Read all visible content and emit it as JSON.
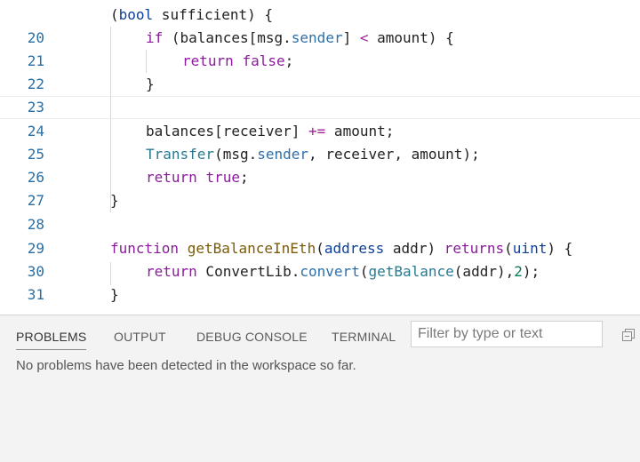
{
  "editor": {
    "lines": [
      {
        "num": "",
        "tokens": [
          [
            "(",
            "p"
          ],
          [
            "bool",
            "t"
          ],
          [
            " sufficient) {",
            "p"
          ]
        ]
      },
      {
        "num": "20",
        "tokens": [
          [
            "if",
            "k"
          ],
          [
            " (balances[",
            "p"
          ],
          [
            "msg",
            ""
          ],
          [
            ".",
            ""
          ],
          [
            "sender",
            "m"
          ],
          [
            "] ",
            "p"
          ],
          [
            "<",
            "o"
          ],
          [
            " amount) {",
            "p"
          ]
        ]
      },
      {
        "num": "21",
        "tokens": [
          [
            "return",
            "k"
          ],
          [
            " ",
            "p"
          ],
          [
            "false",
            "k"
          ],
          [
            ";",
            "p"
          ]
        ]
      },
      {
        "num": "22",
        "tokens": [
          [
            "}",
            "p"
          ]
        ]
      },
      {
        "num": "23",
        "tokens": []
      },
      {
        "num": "24",
        "tokens": [
          [
            "balances[receiver] ",
            "p"
          ],
          [
            "+=",
            "o"
          ],
          [
            " amount;",
            "p"
          ]
        ]
      },
      {
        "num": "25",
        "tokens": [
          [
            "Transfer",
            "e"
          ],
          [
            "(",
            "p"
          ],
          [
            "msg",
            ""
          ],
          [
            ".",
            ""
          ],
          [
            "sender",
            "m"
          ],
          [
            ", receiver, amount);",
            "p"
          ]
        ]
      },
      {
        "num": "26",
        "tokens": [
          [
            "return",
            "k"
          ],
          [
            " ",
            "p"
          ],
          [
            "true",
            "k"
          ],
          [
            ";",
            "p"
          ]
        ]
      },
      {
        "num": "27",
        "tokens": [
          [
            "}",
            "p"
          ]
        ]
      },
      {
        "num": "28",
        "tokens": []
      },
      {
        "num": "29",
        "tokens": [
          [
            "function",
            "k"
          ],
          [
            " ",
            "p"
          ],
          [
            "getBalanceInEth",
            "f"
          ],
          [
            "(",
            "p"
          ],
          [
            "address",
            "t"
          ],
          [
            " addr) ",
            "p"
          ],
          [
            "returns",
            "k"
          ],
          [
            "(",
            "p"
          ],
          [
            "uint",
            "t"
          ],
          [
            ") {",
            "p"
          ]
        ]
      },
      {
        "num": "30",
        "tokens": [
          [
            "return",
            "k"
          ],
          [
            " ConvertLib.",
            "p"
          ],
          [
            "convert",
            "m"
          ],
          [
            "(",
            "p"
          ],
          [
            "getBalance",
            "e"
          ],
          [
            "(addr),",
            "p"
          ],
          [
            "2",
            "n"
          ],
          [
            ");",
            "p"
          ]
        ]
      },
      {
        "num": "31",
        "tokens": [
          [
            "}",
            "p"
          ]
        ]
      }
    ]
  },
  "panel": {
    "tabs": [
      {
        "label": "PROBLEMS",
        "active": true
      },
      {
        "label": "OUTPUT",
        "active": false
      },
      {
        "label": "DEBUG CONSOLE",
        "active": false
      },
      {
        "label": "TERMINAL",
        "active": false
      }
    ],
    "filter_placeholder": "Filter by type or text",
    "message": "No problems have been detected in the workspace so far.",
    "collapse_icon": "collapse-all-icon"
  }
}
